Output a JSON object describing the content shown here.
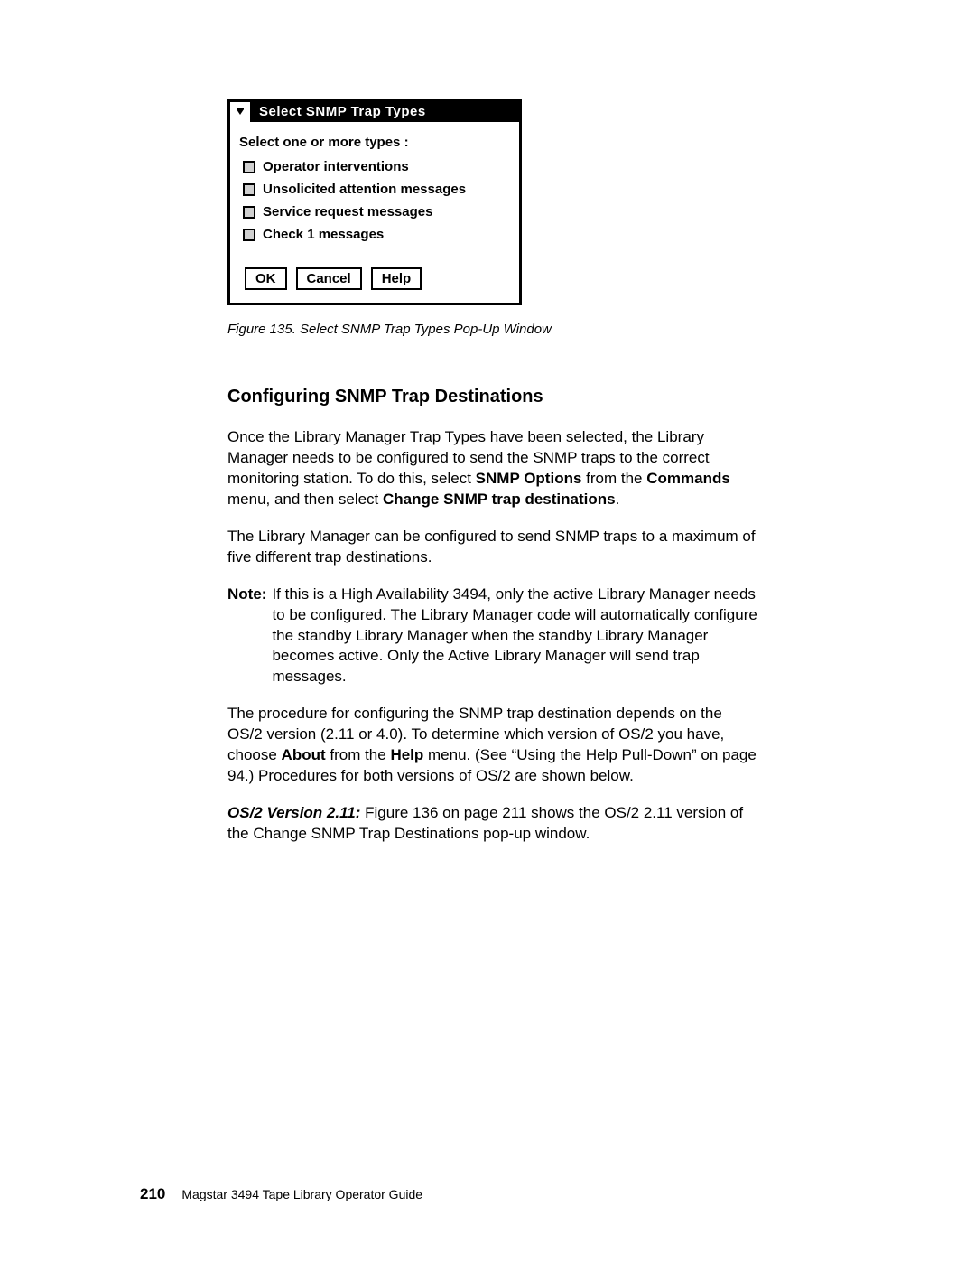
{
  "dialog": {
    "title": "Select SNMP Trap Types",
    "instruction": "Select one or more types :",
    "options": [
      "Operator interventions",
      "Unsolicited attention messages",
      "Service request messages",
      "Check 1 messages"
    ],
    "buttons": {
      "ok": "OK",
      "cancel": "Cancel",
      "help": "Help"
    }
  },
  "figure_caption": "Figure 135. Select SNMP Trap Types Pop-Up Window",
  "heading": "Configuring SNMP Trap Destinations",
  "para1_a": "Once the Library Manager Trap Types have been selected, the Library Manager needs to be configured to send the SNMP traps to the correct monitoring station. To do this, select ",
  "para1_b": "SNMP Options",
  "para1_c": " from the ",
  "para1_d": "Commands",
  "para1_e": " menu, and then select ",
  "para1_f": "Change SNMP trap destinations",
  "para1_g": ".",
  "para2": "The Library Manager can be configured to send SNMP traps to a maximum of five different trap destinations.",
  "note_label": "Note:",
  "note_body": "If this is a High Availability 3494, only the active Library Manager needs to be configured. The Library Manager code will automatically configure the standby Library Manager when the standby Library Manager becomes active. Only the Active Library Manager will send trap messages.",
  "para3_a": "The procedure for configuring the SNMP trap destination depends on the OS/2 version (2.11 or 4.0). To determine which version of OS/2 you have, choose ",
  "para3_b": "About",
  "para3_c": " from the ",
  "para3_d": "Help",
  "para3_e": " menu. (See “Using the Help Pull-Down” on page 94.) Procedures for both versions of OS/2 are shown below.",
  "para4_a": "OS/2 Version 2.11:",
  "para4_b": "   Figure 136 on page 211 shows the OS/2 2.11 version of the Change SNMP Trap Destinations pop-up window.",
  "footer": {
    "page_number": "210",
    "book_title": "Magstar 3494 Tape Library Operator Guide"
  }
}
